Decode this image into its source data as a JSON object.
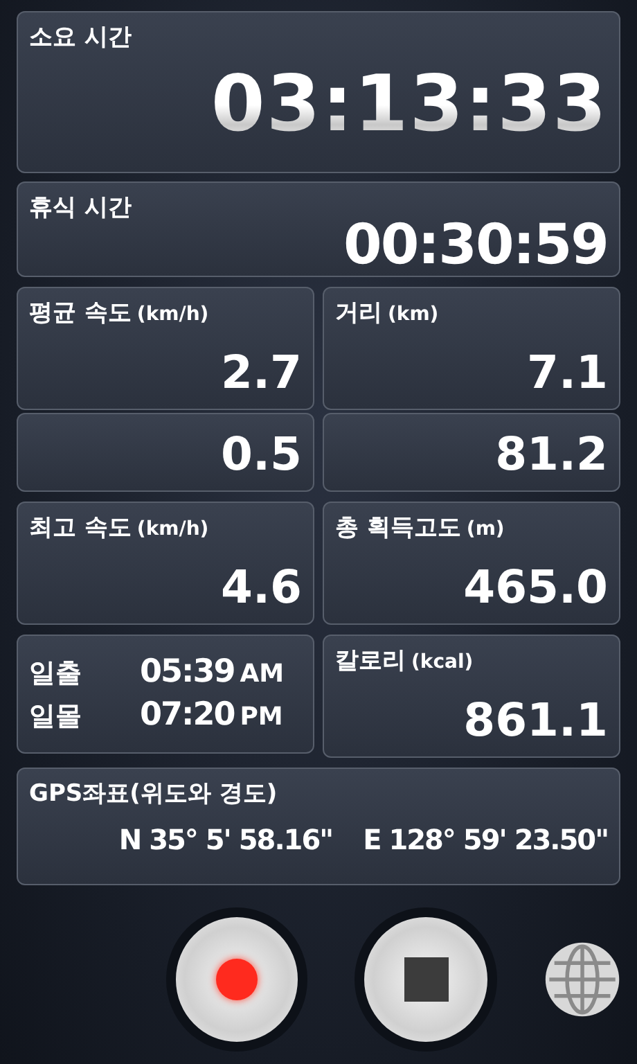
{
  "elapsed": {
    "label": "소요 시간",
    "value": "03:13:33"
  },
  "rest": {
    "label": "휴식 시간",
    "value": "00:30:59"
  },
  "cells": [
    {
      "kind": "stat",
      "label": "평균 속도",
      "unit": "(km/h)",
      "value": "2.7"
    },
    {
      "kind": "stat",
      "label": "거리",
      "unit": "(km)",
      "value": "7.1"
    },
    {
      "kind": "stat",
      "value": "0.5"
    },
    {
      "kind": "stat",
      "value": "81.2"
    },
    {
      "kind": "stat",
      "label": "최고 속도",
      "unit": "(km/h)",
      "value": "4.6"
    },
    {
      "kind": "stat",
      "label": "총 획득고도",
      "unit": "(m)",
      "value": "465.0"
    },
    {
      "kind": "sun",
      "rows": [
        {
          "label": "일출",
          "time": "05:39",
          "suffix": "AM"
        },
        {
          "label": "일몰",
          "time": "07:20",
          "suffix": "PM"
        }
      ]
    },
    {
      "kind": "stat",
      "label": "칼로리",
      "unit": "(kcal)",
      "value": "861.1"
    }
  ],
  "gps": {
    "label": "GPS좌표(위도와 경도)",
    "latitude": "N 35° 5' 58.16\"",
    "longitude": "E 128° 59' 23.50\""
  },
  "controls": [
    {
      "kind": "record"
    },
    {
      "kind": "stop"
    },
    {
      "kind": "globe"
    }
  ]
}
